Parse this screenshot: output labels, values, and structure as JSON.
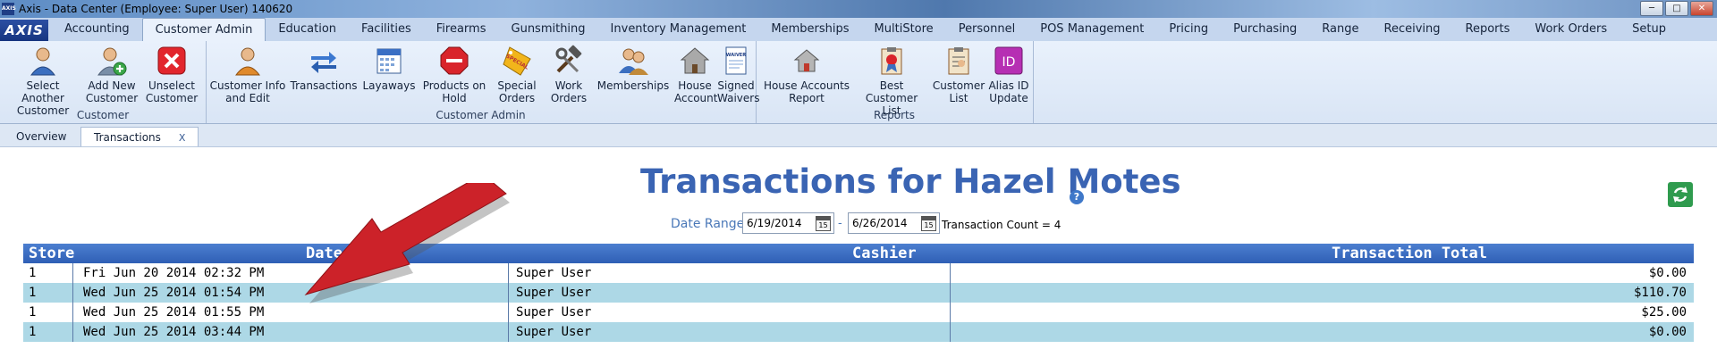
{
  "window": {
    "app_icon": "AXIS",
    "title": "Axis - Data Center  (Employee: Super User) 140620",
    "minimize": "─",
    "maximize": "□",
    "close": "✕"
  },
  "menu": {
    "logo": "AXIS",
    "tabs": [
      "Accounting",
      "Customer Admin",
      "Education",
      "Facilities",
      "Firearms",
      "Gunsmithing",
      "Inventory Management",
      "Memberships",
      "MultiStore",
      "Personnel",
      "POS Management",
      "Pricing",
      "Purchasing",
      "Range",
      "Receiving",
      "Reports",
      "Work Orders",
      "Setup"
    ],
    "active_tab": "Customer Admin"
  },
  "ribbon": {
    "groups": {
      "customer": "Customer",
      "customer_admin": "Customer Admin",
      "reports": "Reports"
    },
    "buttons": {
      "select_another_l1": "Select Another",
      "select_another_l2": "Customer",
      "add_new_l1": "Add New",
      "add_new_l2": "Customer",
      "unselect_l1": "Unselect",
      "unselect_l2": "Customer",
      "info_edit_l1": "Customer Info",
      "info_edit_l2": "and Edit",
      "transactions": "Transactions",
      "layaways": "Layaways",
      "on_hold_l1": "Products on",
      "on_hold_l2": "Hold",
      "special_l1": "Special",
      "special_l2": "Orders",
      "work_orders_l1": "Work",
      "work_orders_l2": "Orders",
      "memberships": "Memberships",
      "house_account_l1": "House",
      "house_account_l2": "Account",
      "signed_waivers_l1": "Signed",
      "signed_waivers_l2": "Waivers",
      "house_report_l1": "House Accounts",
      "house_report_l2": "Report",
      "best_list_l1": "Best Customer",
      "best_list_l2": "List",
      "cust_list_l1": "Customer",
      "cust_list_l2": "List",
      "alias_l1": "Alias ID",
      "alias_l2": "Update"
    },
    "icon_text": {
      "special": "SPECIAL",
      "waiver": "WAIVER",
      "alias": "ID"
    }
  },
  "doc_tabs": {
    "overview": "Overview",
    "transactions": "Transactions",
    "close": "X"
  },
  "main": {
    "title": "Transactions for Hazel Motes",
    "help": "?",
    "date_range_label": "Date Range:",
    "date_from": "6/19/2014",
    "date_to": "6/26/2014",
    "date_sep": "-",
    "cal_day": "15",
    "transaction_count": "Transaction Count = 4"
  },
  "table": {
    "headers": {
      "store": "Store",
      "date": "Date/Time",
      "cashier": "Cashier",
      "total": "Transaction Total"
    },
    "rows": [
      {
        "store": "1",
        "date": "Fri Jun 20 2014 02:32 PM",
        "cashier": "Super User",
        "total": "$0.00"
      },
      {
        "store": "1",
        "date": "Wed Jun 25 2014 01:54 PM",
        "cashier": "Super User",
        "total": "$110.70"
      },
      {
        "store": "1",
        "date": "Wed Jun 25 2014 01:55 PM",
        "cashier": "Super User",
        "total": "$25.00"
      },
      {
        "store": "1",
        "date": "Wed Jun 25 2014 03:44 PM",
        "cashier": "Super User",
        "total": "$0.00"
      }
    ]
  },
  "colors": {
    "accent": "#3a64b3",
    "arrow": "#cc2229",
    "row_alt": "#add8e6",
    "header": "#3f6fc4"
  }
}
